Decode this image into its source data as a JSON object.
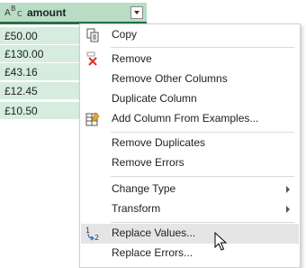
{
  "column": {
    "type_icon": {
      "a": "A",
      "b": "B",
      "c": "C"
    },
    "name": "amount"
  },
  "cells": [
    "£50.00",
    "£130.00",
    "£43.16",
    "£12.45",
    "£10.50"
  ],
  "menu": {
    "copy": "Copy",
    "remove": "Remove",
    "remove_other_columns": "Remove Other Columns",
    "duplicate_column": "Duplicate Column",
    "add_column_from_examples": "Add Column From Examples...",
    "remove_duplicates": "Remove Duplicates",
    "remove_errors": "Remove Errors",
    "change_type": "Change Type",
    "transform": "Transform",
    "replace_values": "Replace Values...",
    "replace_errors": "Replace Errors...",
    "replace_values_icon_text": {
      "top": "1",
      "bottom": "2"
    }
  },
  "colors": {
    "header_bg": "#b9dcc5",
    "header_accent": "#217346",
    "cell_bg": "#d6ecdf",
    "hover_bg": "#e5e5e5",
    "remove_icon": "#d9302c"
  },
  "icons": {
    "copy": "copy-icon",
    "remove": "remove-x-icon",
    "add_column_from_examples": "add-column-examples-icon",
    "replace_values": "replace-values-icon",
    "cursor": "mouse-pointer-icon"
  }
}
